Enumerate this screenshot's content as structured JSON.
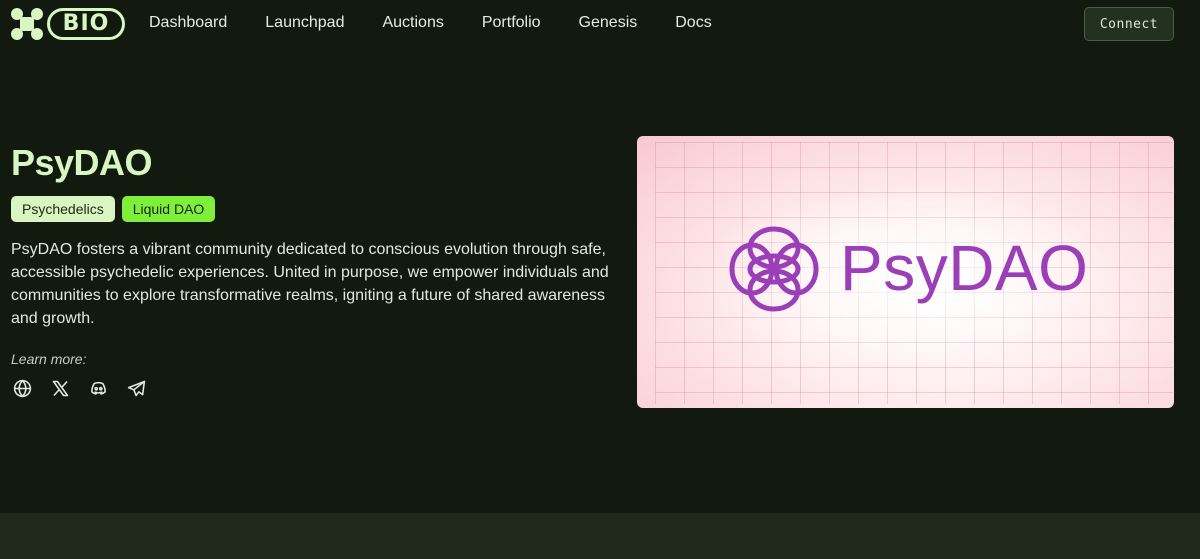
{
  "brand": {
    "logo_text": "BIO",
    "accent_color": "#d9f5c2"
  },
  "nav": {
    "items": [
      {
        "label": "Dashboard"
      },
      {
        "label": "Launchpad"
      },
      {
        "label": "Auctions"
      },
      {
        "label": "Portfolio"
      },
      {
        "label": "Genesis"
      },
      {
        "label": "Docs"
      }
    ],
    "connect_label": "Connect"
  },
  "project": {
    "title": "PsyDAO",
    "tags": [
      {
        "label": "Psychedelics",
        "color": "#d9f5c2"
      },
      {
        "label": "Liquid DAO",
        "color": "#7ef03a"
      }
    ],
    "description": "PsyDAO fosters a vibrant community dedicated to conscious evolution through safe, accessible psychedelic experiences. United in purpose, we empower individuals and communities to explore transformative realms, igniting a future of shared awareness and growth.",
    "learn_more_label": "Learn more:",
    "socials": [
      {
        "icon": "globe-icon"
      },
      {
        "icon": "x-icon"
      },
      {
        "icon": "discord-icon"
      },
      {
        "icon": "telegram-icon"
      }
    ]
  },
  "banner": {
    "wordmark": "PsyDAO",
    "wordmark_color": "#9b3fb8"
  }
}
